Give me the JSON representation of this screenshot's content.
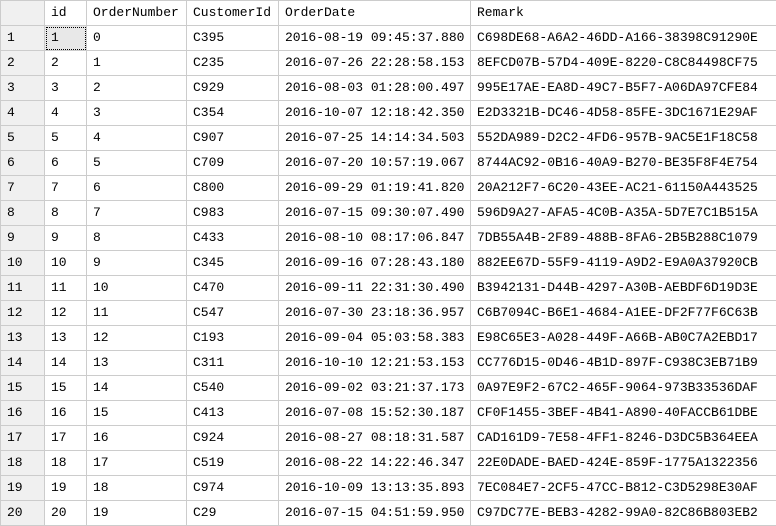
{
  "columns": {
    "id": "id",
    "orderNumber": "OrderNumber",
    "customerId": "CustomerId",
    "orderDate": "OrderDate",
    "remark": "Remark"
  },
  "rows": [
    {
      "n": "1",
      "id": "1",
      "orderNumber": "0",
      "customerId": "C395",
      "orderDate": "2016-08-19 09:45:37.880",
      "remark": "C698DE68-A6A2-46DD-A166-38398C91290E"
    },
    {
      "n": "2",
      "id": "2",
      "orderNumber": "1",
      "customerId": "C235",
      "orderDate": "2016-07-26 22:28:58.153",
      "remark": "8EFCD07B-57D4-409E-8220-C8C84498CF75"
    },
    {
      "n": "3",
      "id": "3",
      "orderNumber": "2",
      "customerId": "C929",
      "orderDate": "2016-08-03 01:28:00.497",
      "remark": "995E17AE-EA8D-49C7-B5F7-A06DA97CFE84"
    },
    {
      "n": "4",
      "id": "4",
      "orderNumber": "3",
      "customerId": "C354",
      "orderDate": "2016-10-07 12:18:42.350",
      "remark": "E2D3321B-DC46-4D58-85FE-3DC1671E29AF"
    },
    {
      "n": "5",
      "id": "5",
      "orderNumber": "4",
      "customerId": "C907",
      "orderDate": "2016-07-25 14:14:34.503",
      "remark": "552DA989-D2C2-4FD6-957B-9AC5E1F18C58"
    },
    {
      "n": "6",
      "id": "6",
      "orderNumber": "5",
      "customerId": "C709",
      "orderDate": "2016-07-20 10:57:19.067",
      "remark": "8744AC92-0B16-40A9-B270-BE35F8F4E754"
    },
    {
      "n": "7",
      "id": "7",
      "orderNumber": "6",
      "customerId": "C800",
      "orderDate": "2016-09-29 01:19:41.820",
      "remark": "20A212F7-6C20-43EE-AC21-61150A443525"
    },
    {
      "n": "8",
      "id": "8",
      "orderNumber": "7",
      "customerId": "C983",
      "orderDate": "2016-07-15 09:30:07.490",
      "remark": "596D9A27-AFA5-4C0B-A35A-5D7E7C1B515A"
    },
    {
      "n": "9",
      "id": "9",
      "orderNumber": "8",
      "customerId": "C433",
      "orderDate": "2016-08-10 08:17:06.847",
      "remark": "7DB55A4B-2F89-488B-8FA6-2B5B288C1079"
    },
    {
      "n": "10",
      "id": "10",
      "orderNumber": "9",
      "customerId": "C345",
      "orderDate": "2016-09-16 07:28:43.180",
      "remark": "882EE67D-55F9-4119-A9D2-E9A0A37920CB"
    },
    {
      "n": "11",
      "id": "11",
      "orderNumber": "10",
      "customerId": "C470",
      "orderDate": "2016-09-11 22:31:30.490",
      "remark": "B3942131-D44B-4297-A30B-AEBDF6D19D3E"
    },
    {
      "n": "12",
      "id": "12",
      "orderNumber": "11",
      "customerId": "C547",
      "orderDate": "2016-07-30 23:18:36.957",
      "remark": "C6B7094C-B6E1-4684-A1EE-DF2F77F6C63B"
    },
    {
      "n": "13",
      "id": "13",
      "orderNumber": "12",
      "customerId": "C193",
      "orderDate": "2016-09-04 05:03:58.383",
      "remark": "E98C65E3-A028-449F-A66B-AB0C7A2EBD17"
    },
    {
      "n": "14",
      "id": "14",
      "orderNumber": "13",
      "customerId": "C311",
      "orderDate": "2016-10-10 12:21:53.153",
      "remark": "CC776D15-0D46-4B1D-897F-C938C3EB71B9"
    },
    {
      "n": "15",
      "id": "15",
      "orderNumber": "14",
      "customerId": "C540",
      "orderDate": "2016-09-02 03:21:37.173",
      "remark": "0A97E9F2-67C2-465F-9064-973B33536DAF"
    },
    {
      "n": "16",
      "id": "16",
      "orderNumber": "15",
      "customerId": "C413",
      "orderDate": "2016-07-08 15:52:30.187",
      "remark": "CF0F1455-3BEF-4B41-A890-40FACCB61DBE"
    },
    {
      "n": "17",
      "id": "17",
      "orderNumber": "16",
      "customerId": "C924",
      "orderDate": "2016-08-27 08:18:31.587",
      "remark": "CAD161D9-7E58-4FF1-8246-D3DC5B364EEA"
    },
    {
      "n": "18",
      "id": "18",
      "orderNumber": "17",
      "customerId": "C519",
      "orderDate": "2016-08-22 14:22:46.347",
      "remark": "22E0DADE-BAED-424E-859F-1775A1322356"
    },
    {
      "n": "19",
      "id": "19",
      "orderNumber": "18",
      "customerId": "C974",
      "orderDate": "2016-10-09 13:13:35.893",
      "remark": "7EC084E7-2CF5-47CC-B812-C3D5298E30AF"
    },
    {
      "n": "20",
      "id": "20",
      "orderNumber": "19",
      "customerId": "C29",
      "orderDate": "2016-07-15 04:51:59.950",
      "remark": "C97DC77E-BEB3-4282-99A0-82C86B803EB2"
    }
  ],
  "selected": {
    "row": 0,
    "col": "id"
  }
}
